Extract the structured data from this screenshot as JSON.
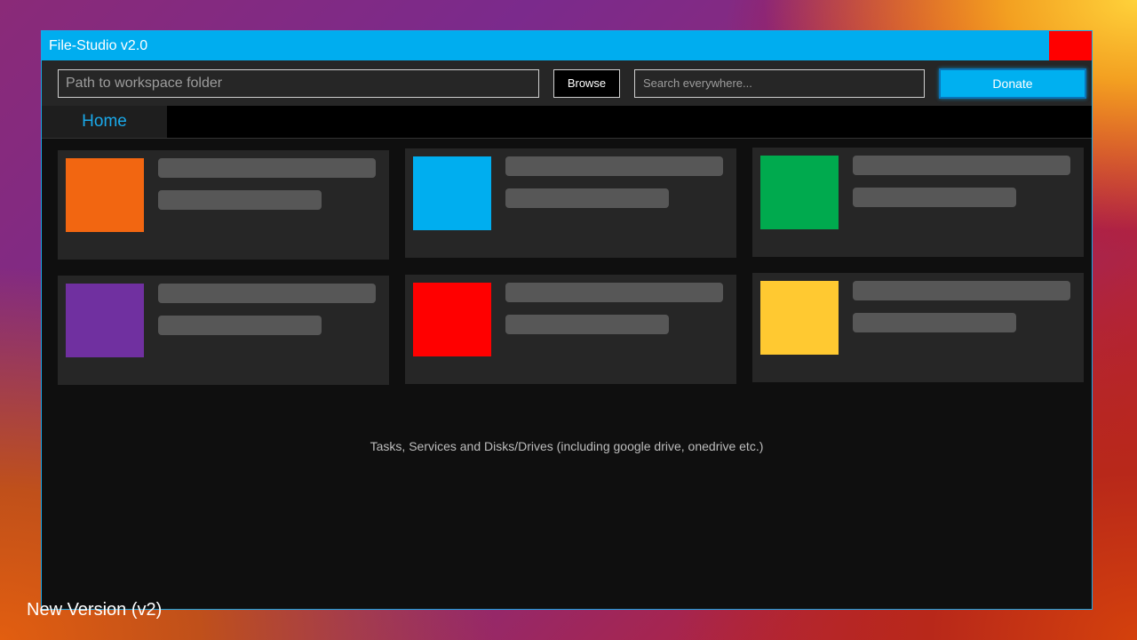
{
  "window": {
    "title": "File-Studio v2.0"
  },
  "toolbar": {
    "path_placeholder": "Path to workspace folder",
    "browse_label": "Browse",
    "search_placeholder": "Search everywhere...",
    "donate_label": "Donate"
  },
  "tabs": [
    {
      "label": "Home",
      "active": true
    }
  ],
  "cards": [
    {
      "color": "#f26611"
    },
    {
      "color": "#00aeef"
    },
    {
      "color": "#00aa4e"
    },
    {
      "color": "#7030a0"
    },
    {
      "color": "#ff0000"
    },
    {
      "color": "#ffc931"
    }
  ],
  "footer_note": "Tasks, Services and Disks/Drives (including google drive, onedrive etc.)",
  "caption": "New Version (v2)",
  "colors": {
    "accent": "#00adef",
    "close": "#ff0000",
    "window_bg": "#0f0f0f",
    "panel_bg": "#262626"
  }
}
